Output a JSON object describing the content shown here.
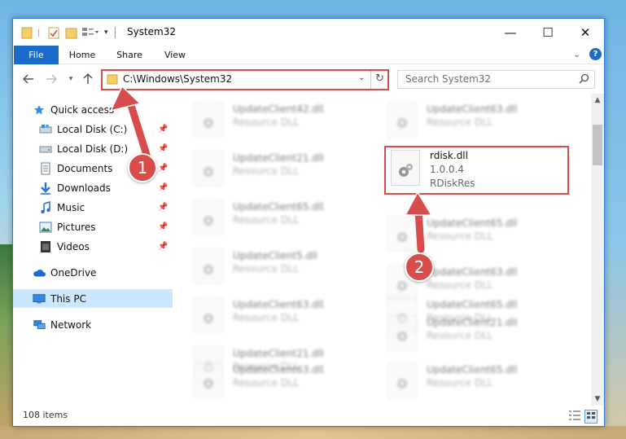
{
  "window": {
    "title": "System32",
    "controls": {
      "minimize": "—",
      "maximize": "☐",
      "close": "✕"
    }
  },
  "ribbon": {
    "tabs": [
      "File",
      "Home",
      "Share",
      "View"
    ]
  },
  "navigation": {
    "address": "C:\\Windows\\System32",
    "search_placeholder": "Search System32"
  },
  "sidebar": {
    "items": [
      {
        "label": "Quick access",
        "icon": "star-icon",
        "pinned": false
      },
      {
        "label": "Local Disk (C:)",
        "icon": "drive-icon",
        "pinned": true
      },
      {
        "label": "Local Disk (D:)",
        "icon": "drive-icon",
        "pinned": true
      },
      {
        "label": "Documents",
        "icon": "documents-icon",
        "pinned": true
      },
      {
        "label": "Downloads",
        "icon": "downloads-icon",
        "pinned": true
      },
      {
        "label": "Music",
        "icon": "music-icon",
        "pinned": true
      },
      {
        "label": "Pictures",
        "icon": "pictures-icon",
        "pinned": true
      },
      {
        "label": "Videos",
        "icon": "videos-icon",
        "pinned": true
      },
      {
        "label": "OneDrive",
        "icon": "onedrive-icon",
        "pinned": false
      },
      {
        "label": "This PC",
        "icon": "this-pc-icon",
        "pinned": false,
        "selected": true
      },
      {
        "label": "Network",
        "icon": "network-icon",
        "pinned": false
      }
    ]
  },
  "files": {
    "left_column": [
      {
        "name": "UpdateClient42.dll",
        "type": "Resource DLL"
      },
      {
        "name": "UpdateClient21.dll",
        "type": "Resource DLL"
      },
      {
        "name": "UpdateClient65.dll",
        "type": "Resource DLL"
      },
      {
        "name": "UpdateClient5.dll",
        "type": "Resource DLL"
      },
      {
        "name": "UpdateClient63.dll",
        "type": "Resource DLL"
      },
      {
        "name": "UpdateClient21.dll",
        "type": "Resource DLL"
      },
      {
        "name": "UpdateClient63.dll",
        "type": "Resource DLL"
      }
    ],
    "right_column": [
      {
        "name": "UpdateClient63.dll",
        "type": "Resource DLL"
      },
      {
        "name": "UpdateClient65.dll",
        "type": "Resource DLL"
      },
      {
        "name": "UpdateClient63.dll",
        "type": "Resource DLL"
      },
      {
        "name": "UpdateClient65.dll",
        "type": "Resource DLL"
      },
      {
        "name": "UpdateClient21.dll",
        "type": "Resource DLL"
      },
      {
        "name": "UpdateClient65.dll",
        "type": "Resource DLL"
      }
    ],
    "highlighted": {
      "name": "rdisk.dll",
      "version": "1.0.0.4",
      "description": "RDiskRes"
    }
  },
  "status": {
    "item_count": "108 items"
  },
  "annotations": {
    "marker_1": "1",
    "marker_2": "2",
    "color": "#d84c4c"
  }
}
